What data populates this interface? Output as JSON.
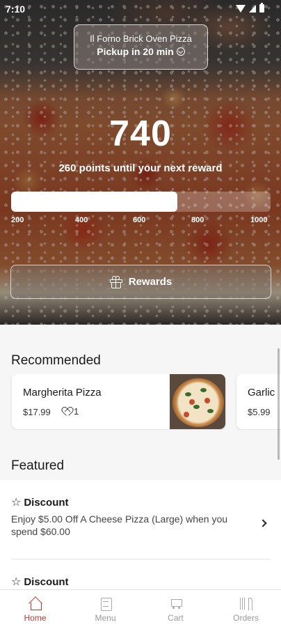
{
  "status_bar": {
    "time": "7:10"
  },
  "header": {
    "store_name": "Il Forno Brick Oven Pizza",
    "pickup_label": "Pickup in 20 min"
  },
  "loyalty": {
    "points": "740",
    "caption": "260 points until your next reward",
    "progress_fraction": 0.64,
    "ticks": [
      "200",
      "400",
      "600",
      "800",
      "1000"
    ],
    "rewards_button_label": "Rewards"
  },
  "recommended": {
    "title": "Recommended",
    "items": [
      {
        "name": "Margherita Pizza",
        "price": "$17.99",
        "likes": "1"
      },
      {
        "name": "Garlic",
        "price": "$5.99"
      }
    ]
  },
  "featured": {
    "title": "Featured",
    "items": [
      {
        "tag": "Discount",
        "description": "Enjoy $5.00 Off A Cheese Pizza (Large) when you spend $60.00"
      },
      {
        "tag": "Discount"
      }
    ]
  },
  "bottom_nav": {
    "items": [
      {
        "label": "Home",
        "icon": "home-icon",
        "active": true
      },
      {
        "label": "Menu",
        "icon": "menu-icon",
        "active": false
      },
      {
        "label": "Cart",
        "icon": "cart-icon",
        "active": false
      },
      {
        "label": "Orders",
        "icon": "utensils-icon",
        "active": false
      }
    ]
  },
  "colors": {
    "accent": "#c0392b",
    "nav_inactive": "#9a9a9a",
    "background": "#f6f6f6"
  }
}
